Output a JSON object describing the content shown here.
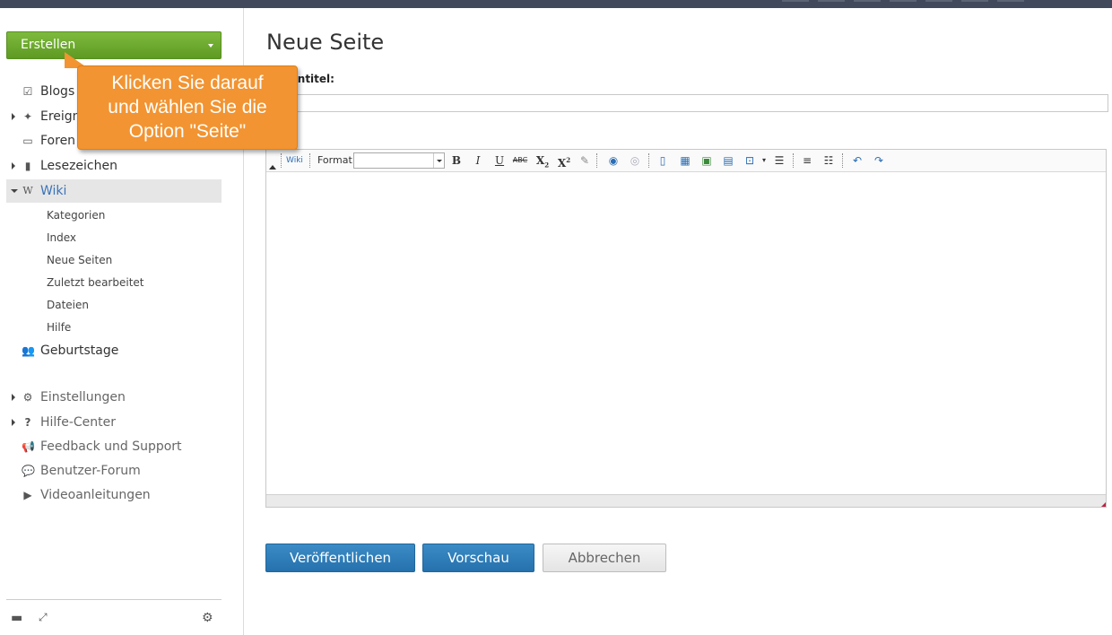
{
  "sidebar": {
    "create_label": "Erstellen",
    "items": [
      {
        "label": "Blogs",
        "icon": "edit-icon"
      },
      {
        "label": "Ereignisse",
        "icon": "pin-icon"
      },
      {
        "label": "Foren",
        "icon": "chat-icon"
      },
      {
        "label": "Lesezeichen",
        "icon": "bookmark-icon"
      },
      {
        "label": "Wiki",
        "icon": "wiki-icon"
      }
    ],
    "wiki_sub": [
      "Kategorien",
      "Index",
      "Neue Seiten",
      "Zuletzt bearbeitet",
      "Dateien",
      "Hilfe"
    ],
    "birthdays": "Geburtstage",
    "secondary": [
      {
        "label": "Einstellungen",
        "icon": "gear-icon"
      },
      {
        "label": "Hilfe-Center",
        "icon": "question-icon"
      },
      {
        "label": "Feedback und Support",
        "icon": "megaphone-icon"
      },
      {
        "label": "Benutzer-Forum",
        "icon": "speech-bubble-icon"
      },
      {
        "label": "Videoanleitungen",
        "icon": "video-icon"
      }
    ]
  },
  "callout": {
    "lines": [
      "Klicken Sie darauf",
      "und wählen Sie die",
      "Option \"Seite\""
    ]
  },
  "main": {
    "page_title": "Neue Seite",
    "title_field_label": "Seitentitel:",
    "title_value": "",
    "format_label": "Format",
    "format_value": "",
    "publish_label": "Veröffentlichen",
    "preview_label": "Vorschau",
    "cancel_label": "Abbrechen"
  },
  "colors": {
    "create_green": "#6aab2e",
    "callout_orange": "#f29432",
    "primary_blue": "#2f7fbd",
    "active_link": "#3b73b9"
  }
}
